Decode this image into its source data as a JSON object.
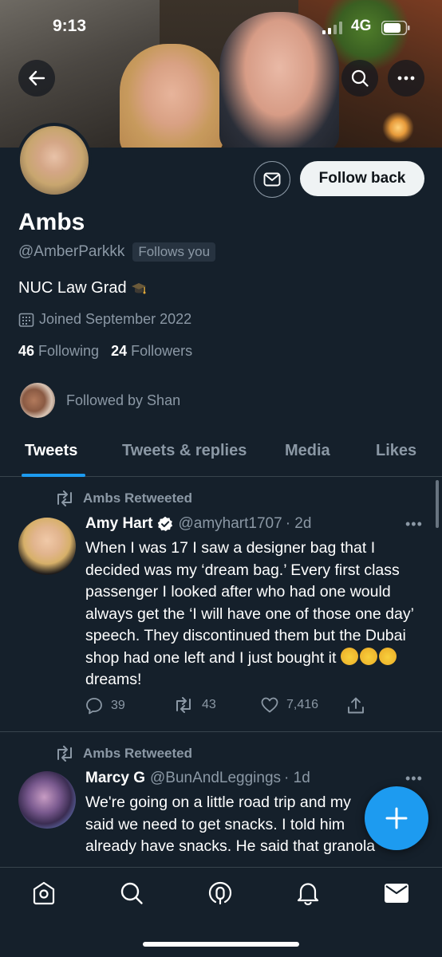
{
  "status_bar": {
    "time": "9:13",
    "network": "4G"
  },
  "profile": {
    "display_name": "Ambs",
    "handle": "@AmberParkkk",
    "follows_you": "Follows you",
    "bio": "NUC Law Grad",
    "joined": "Joined September 2022",
    "following_count": "46",
    "following_label": "Following",
    "followers_count": "24",
    "followers_label": "Followers",
    "followed_by": "Followed by Shan",
    "follow_button": "Follow back"
  },
  "tabs": [
    {
      "label": "Tweets",
      "active": true
    },
    {
      "label": "Tweets & replies",
      "active": false
    },
    {
      "label": "Media",
      "active": false
    },
    {
      "label": "Likes",
      "active": false
    }
  ],
  "tweets": [
    {
      "retweeted_by": "Ambs Retweeted",
      "name": "Amy Hart",
      "verified": true,
      "handle": "@amyhart1707",
      "time": "· 2d",
      "text": "When I was 17 I saw a designer bag that I decided was my ‘dream bag.’ Every first class passenger I looked after who had one would always get the ‘I will have one of those one day’ speech. They discontinued them but the Dubai shop had one left and I just bought it",
      "text_end": "dreams!",
      "emoji": "🤩🤩🤩",
      "replies": "39",
      "retweets": "43",
      "likes": "7,416"
    },
    {
      "retweeted_by": "Ambs Retweeted",
      "name": "Marcy G",
      "verified": false,
      "handle": "@BunAndLeggings",
      "time": "· 1d",
      "line1": "We're going on a little road trip and my",
      "line2": "said we need to get snacks. I told him",
      "line3": "already have snacks. He said that granola"
    }
  ],
  "icons": {
    "back": "back-arrow-icon",
    "search": "search-icon",
    "more": "more-icon",
    "message": "envelope-icon",
    "calendar": "calendar-icon",
    "retweet": "retweet-icon",
    "reply": "reply-icon",
    "like": "heart-icon",
    "share": "share-icon",
    "compose": "plus-icon",
    "nav_home": "home-icon",
    "nav_search": "search-icon",
    "nav_spaces": "spaces-icon",
    "nav_notifications": "bell-icon",
    "nav_messages": "envelope-icon"
  },
  "colors": {
    "background": "#15202b",
    "accent": "#1d9bf0",
    "secondary_text": "#8b98a5",
    "divider": "#38444d"
  }
}
